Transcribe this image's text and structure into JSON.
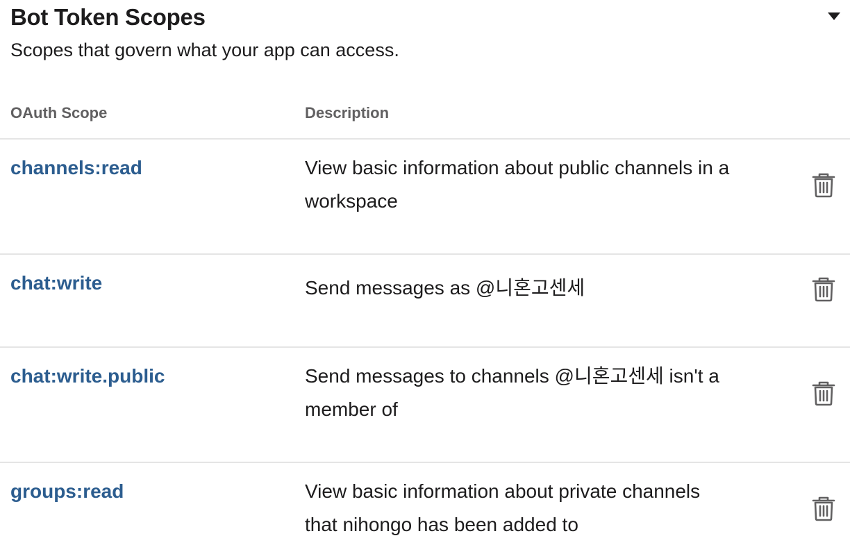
{
  "section": {
    "title": "Bot Token Scopes",
    "subtitle": "Scopes that govern what your app can access."
  },
  "table": {
    "headers": {
      "scope": "OAuth Scope",
      "description": "Description"
    },
    "rows": [
      {
        "scope": "channels:read",
        "description": "View basic information about public channels in a workspace"
      },
      {
        "scope": "chat:write",
        "description": "Send messages as @니혼고센세"
      },
      {
        "scope": "chat:write.public",
        "description": "Send messages to channels @니혼고센세 isn't a member of"
      },
      {
        "scope": "groups:read",
        "description": "View basic information about private channels that nihongo has been added to"
      }
    ]
  },
  "icons": {
    "collapse": "caret-down-icon",
    "remove": "trash-icon"
  },
  "colors": {
    "link": "#2c5d8f",
    "header_text": "#616061",
    "divider": "#e5e5e5",
    "icon": "#616061"
  }
}
